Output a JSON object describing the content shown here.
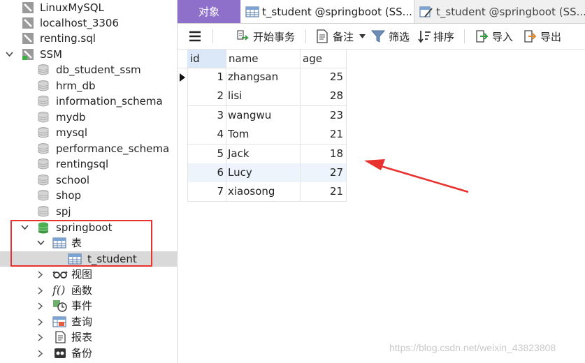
{
  "sidebar": {
    "connections": [
      {
        "label": "LinuxMySQL"
      },
      {
        "label": "localhost_3306"
      },
      {
        "label": "renting.sql"
      }
    ],
    "ssm": {
      "label": "SSM"
    },
    "databases": [
      {
        "label": "db_student_ssm"
      },
      {
        "label": "hrm_db"
      },
      {
        "label": "information_schema"
      },
      {
        "label": "mydb"
      },
      {
        "label": "mysql"
      },
      {
        "label": "performance_schema"
      },
      {
        "label": "rentingsql"
      },
      {
        "label": "school"
      },
      {
        "label": "shop"
      },
      {
        "label": "spj"
      }
    ],
    "springboot": {
      "label": "springboot",
      "tables_label": "表",
      "table_item": "t_student",
      "children": [
        {
          "label": "视图",
          "icon": "view-icon"
        },
        {
          "label": "函数",
          "icon": "function-icon"
        },
        {
          "label": "事件",
          "icon": "event-icon"
        },
        {
          "label": "查询",
          "icon": "query-icon"
        },
        {
          "label": "报表",
          "icon": "report-icon"
        },
        {
          "label": "备份",
          "icon": "backup-icon"
        }
      ]
    }
  },
  "tabs": {
    "objects": "对象",
    "tab1": "t_student @springboot (SS...",
    "tab2": "t_student @springboot (SS..."
  },
  "toolbar": {
    "begin_transaction": "开始事务",
    "note": "备注",
    "filter": "筛选",
    "sort": "排序",
    "import": "导入",
    "export": "导出"
  },
  "grid": {
    "columns": [
      "id",
      "name",
      "age"
    ],
    "rows": [
      {
        "id": "1",
        "name": "zhangsan",
        "age": "25"
      },
      {
        "id": "2",
        "name": "lisi",
        "age": "28"
      },
      {
        "id": "3",
        "name": "wangwu",
        "age": "23"
      },
      {
        "id": "4",
        "name": "Tom",
        "age": "21"
      },
      {
        "id": "5",
        "name": "Jack",
        "age": "18"
      },
      {
        "id": "6",
        "name": "Lucy",
        "age": "27"
      },
      {
        "id": "7",
        "name": "xiaosong",
        "age": "21"
      }
    ]
  },
  "colors": {
    "objects_tab": "#8e6fc9",
    "highlight_box": "#e8322e",
    "annotation_arrow": "#e8322e",
    "selected_row": "#d9d9d9",
    "active_header": "#dbe8f7"
  },
  "watermark": "https://blog.csdn.net/weixin_43823808"
}
